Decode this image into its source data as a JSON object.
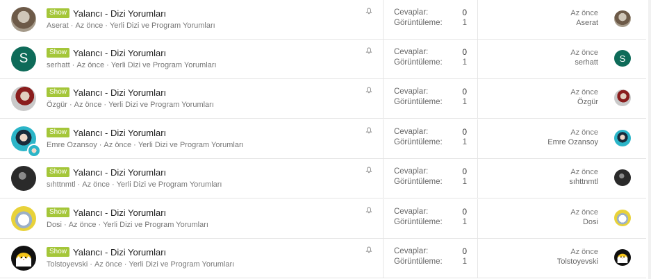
{
  "topics": [
    {
      "prefix": "Show",
      "title": "Yalancı - Dizi Yorumları",
      "author": "Aserat",
      "time": "Az önce",
      "forum": "Yerli Dizi ve Program Yorumları",
      "replies_label": "Cevaplar:",
      "replies": "0",
      "views_label": "Görüntüleme:",
      "views": "1",
      "last_time": "Az önce",
      "last_user": "Aserat",
      "avatar": "photo-woman",
      "avatar_letter": ""
    },
    {
      "prefix": "Show",
      "title": "Yalancı - Dizi Yorumları",
      "author": "serhatt",
      "time": "Az önce",
      "forum": "Yerli Dizi ve Program Yorumları",
      "replies_label": "Cevaplar:",
      "replies": "0",
      "views_label": "Görüntüleme:",
      "views": "1",
      "last_time": "Az önce",
      "last_user": "serhatt",
      "avatar": "letter",
      "avatar_letter": "S"
    },
    {
      "prefix": "Show",
      "title": "Yalancı - Dizi Yorumları",
      "author": "Özgür",
      "time": "Az önce",
      "forum": "Yerli Dizi ve Program Yorumları",
      "replies_label": "Cevaplar:",
      "replies": "0",
      "views_label": "Görüntüleme:",
      "views": "1",
      "last_time": "Az önce",
      "last_user": "Özgür",
      "avatar": "photo-man-red",
      "avatar_letter": ""
    },
    {
      "prefix": "Show",
      "title": "Yalancı - Dizi Yorumları",
      "author": "Emre Ozansoy",
      "time": "Az önce",
      "forum": "Yerli Dizi ve Program Yorumları",
      "replies_label": "Cevaplar:",
      "replies": "0",
      "views_label": "Görüntüleme:",
      "views": "1",
      "last_time": "Az önce",
      "last_user": "Emre Ozansoy",
      "avatar": "photo-woman-teal",
      "avatar_letter": ""
    },
    {
      "prefix": "Show",
      "title": "Yalancı - Dizi Yorumları",
      "author": "sıhttnmtl",
      "time": "Az önce",
      "forum": "Yerli Dizi ve Program Yorumları",
      "replies_label": "Cevaplar:",
      "replies": "0",
      "views_label": "Görüntüleme:",
      "views": "1",
      "last_time": "Az önce",
      "last_user": "sıhttnmtl",
      "avatar": "photo-dark",
      "avatar_letter": ""
    },
    {
      "prefix": "Show",
      "title": "Yalancı - Dizi Yorumları",
      "author": "Dosi",
      "time": "Az önce",
      "forum": "Yerli Dizi ve Program Yorumları",
      "replies_label": "Cevaplar:",
      "replies": "0",
      "views_label": "Görüntüleme:",
      "views": "1",
      "last_time": "Az önce",
      "last_user": "Dosi",
      "avatar": "photo-cartoon",
      "avatar_letter": ""
    },
    {
      "prefix": "Show",
      "title": "Yalancı - Dizi Yorumları",
      "author": "Tolstoyevski",
      "time": "Az önce",
      "forum": "Yerli Dizi ve Program Yorumları",
      "replies_label": "Cevaplar:",
      "replies": "0",
      "views_label": "Görüntüleme:",
      "views": "1",
      "last_time": "Az önce",
      "last_user": "Tolstoyevski",
      "avatar": "photo-chick",
      "avatar_letter": ""
    }
  ],
  "colors": {
    "prefix_bg": "#a4c639",
    "letter_avatar_bg": "#0e6b59",
    "border": "#e5e5e5"
  },
  "icons": {
    "watch": "bell-icon"
  }
}
